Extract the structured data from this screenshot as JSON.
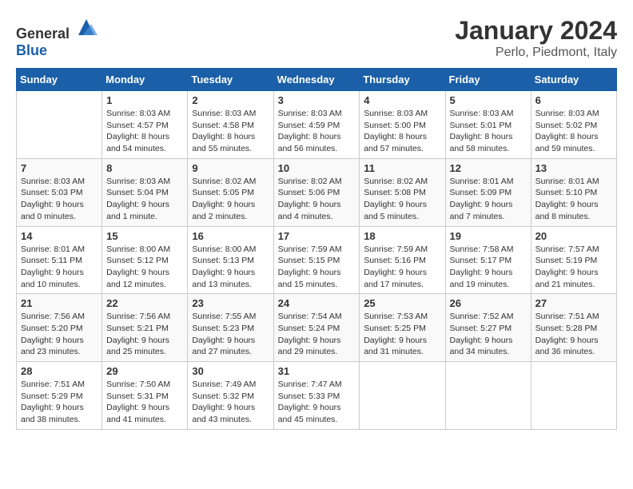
{
  "logo": {
    "general": "General",
    "blue": "Blue"
  },
  "title": "January 2024",
  "location": "Perlo, Piedmont, Italy",
  "days_of_week": [
    "Sunday",
    "Monday",
    "Tuesday",
    "Wednesday",
    "Thursday",
    "Friday",
    "Saturday"
  ],
  "weeks": [
    [
      {
        "num": "",
        "sunrise": "",
        "sunset": "",
        "daylight": ""
      },
      {
        "num": "1",
        "sunrise": "Sunrise: 8:03 AM",
        "sunset": "Sunset: 4:57 PM",
        "daylight": "Daylight: 8 hours and 54 minutes."
      },
      {
        "num": "2",
        "sunrise": "Sunrise: 8:03 AM",
        "sunset": "Sunset: 4:58 PM",
        "daylight": "Daylight: 8 hours and 55 minutes."
      },
      {
        "num": "3",
        "sunrise": "Sunrise: 8:03 AM",
        "sunset": "Sunset: 4:59 PM",
        "daylight": "Daylight: 8 hours and 56 minutes."
      },
      {
        "num": "4",
        "sunrise": "Sunrise: 8:03 AM",
        "sunset": "Sunset: 5:00 PM",
        "daylight": "Daylight: 8 hours and 57 minutes."
      },
      {
        "num": "5",
        "sunrise": "Sunrise: 8:03 AM",
        "sunset": "Sunset: 5:01 PM",
        "daylight": "Daylight: 8 hours and 58 minutes."
      },
      {
        "num": "6",
        "sunrise": "Sunrise: 8:03 AM",
        "sunset": "Sunset: 5:02 PM",
        "daylight": "Daylight: 8 hours and 59 minutes."
      }
    ],
    [
      {
        "num": "7",
        "sunrise": "Sunrise: 8:03 AM",
        "sunset": "Sunset: 5:03 PM",
        "daylight": "Daylight: 9 hours and 0 minutes."
      },
      {
        "num": "8",
        "sunrise": "Sunrise: 8:03 AM",
        "sunset": "Sunset: 5:04 PM",
        "daylight": "Daylight: 9 hours and 1 minute."
      },
      {
        "num": "9",
        "sunrise": "Sunrise: 8:02 AM",
        "sunset": "Sunset: 5:05 PM",
        "daylight": "Daylight: 9 hours and 2 minutes."
      },
      {
        "num": "10",
        "sunrise": "Sunrise: 8:02 AM",
        "sunset": "Sunset: 5:06 PM",
        "daylight": "Daylight: 9 hours and 4 minutes."
      },
      {
        "num": "11",
        "sunrise": "Sunrise: 8:02 AM",
        "sunset": "Sunset: 5:08 PM",
        "daylight": "Daylight: 9 hours and 5 minutes."
      },
      {
        "num": "12",
        "sunrise": "Sunrise: 8:01 AM",
        "sunset": "Sunset: 5:09 PM",
        "daylight": "Daylight: 9 hours and 7 minutes."
      },
      {
        "num": "13",
        "sunrise": "Sunrise: 8:01 AM",
        "sunset": "Sunset: 5:10 PM",
        "daylight": "Daylight: 9 hours and 8 minutes."
      }
    ],
    [
      {
        "num": "14",
        "sunrise": "Sunrise: 8:01 AM",
        "sunset": "Sunset: 5:11 PM",
        "daylight": "Daylight: 9 hours and 10 minutes."
      },
      {
        "num": "15",
        "sunrise": "Sunrise: 8:00 AM",
        "sunset": "Sunset: 5:12 PM",
        "daylight": "Daylight: 9 hours and 12 minutes."
      },
      {
        "num": "16",
        "sunrise": "Sunrise: 8:00 AM",
        "sunset": "Sunset: 5:13 PM",
        "daylight": "Daylight: 9 hours and 13 minutes."
      },
      {
        "num": "17",
        "sunrise": "Sunrise: 7:59 AM",
        "sunset": "Sunset: 5:15 PM",
        "daylight": "Daylight: 9 hours and 15 minutes."
      },
      {
        "num": "18",
        "sunrise": "Sunrise: 7:59 AM",
        "sunset": "Sunset: 5:16 PM",
        "daylight": "Daylight: 9 hours and 17 minutes."
      },
      {
        "num": "19",
        "sunrise": "Sunrise: 7:58 AM",
        "sunset": "Sunset: 5:17 PM",
        "daylight": "Daylight: 9 hours and 19 minutes."
      },
      {
        "num": "20",
        "sunrise": "Sunrise: 7:57 AM",
        "sunset": "Sunset: 5:19 PM",
        "daylight": "Daylight: 9 hours and 21 minutes."
      }
    ],
    [
      {
        "num": "21",
        "sunrise": "Sunrise: 7:56 AM",
        "sunset": "Sunset: 5:20 PM",
        "daylight": "Daylight: 9 hours and 23 minutes."
      },
      {
        "num": "22",
        "sunrise": "Sunrise: 7:56 AM",
        "sunset": "Sunset: 5:21 PM",
        "daylight": "Daylight: 9 hours and 25 minutes."
      },
      {
        "num": "23",
        "sunrise": "Sunrise: 7:55 AM",
        "sunset": "Sunset: 5:23 PM",
        "daylight": "Daylight: 9 hours and 27 minutes."
      },
      {
        "num": "24",
        "sunrise": "Sunrise: 7:54 AM",
        "sunset": "Sunset: 5:24 PM",
        "daylight": "Daylight: 9 hours and 29 minutes."
      },
      {
        "num": "25",
        "sunrise": "Sunrise: 7:53 AM",
        "sunset": "Sunset: 5:25 PM",
        "daylight": "Daylight: 9 hours and 31 minutes."
      },
      {
        "num": "26",
        "sunrise": "Sunrise: 7:52 AM",
        "sunset": "Sunset: 5:27 PM",
        "daylight": "Daylight: 9 hours and 34 minutes."
      },
      {
        "num": "27",
        "sunrise": "Sunrise: 7:51 AM",
        "sunset": "Sunset: 5:28 PM",
        "daylight": "Daylight: 9 hours and 36 minutes."
      }
    ],
    [
      {
        "num": "28",
        "sunrise": "Sunrise: 7:51 AM",
        "sunset": "Sunset: 5:29 PM",
        "daylight": "Daylight: 9 hours and 38 minutes."
      },
      {
        "num": "29",
        "sunrise": "Sunrise: 7:50 AM",
        "sunset": "Sunset: 5:31 PM",
        "daylight": "Daylight: 9 hours and 41 minutes."
      },
      {
        "num": "30",
        "sunrise": "Sunrise: 7:49 AM",
        "sunset": "Sunset: 5:32 PM",
        "daylight": "Daylight: 9 hours and 43 minutes."
      },
      {
        "num": "31",
        "sunrise": "Sunrise: 7:47 AM",
        "sunset": "Sunset: 5:33 PM",
        "daylight": "Daylight: 9 hours and 45 minutes."
      },
      {
        "num": "",
        "sunrise": "",
        "sunset": "",
        "daylight": ""
      },
      {
        "num": "",
        "sunrise": "",
        "sunset": "",
        "daylight": ""
      },
      {
        "num": "",
        "sunrise": "",
        "sunset": "",
        "daylight": ""
      }
    ]
  ]
}
